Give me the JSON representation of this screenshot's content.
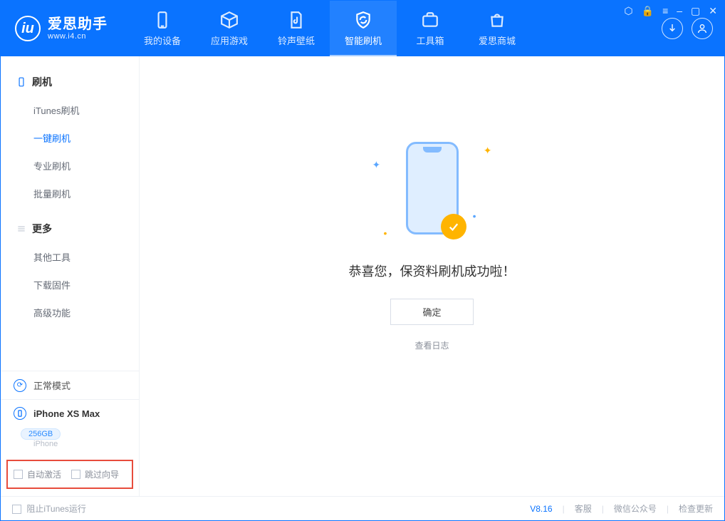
{
  "app": {
    "name": "爱思助手",
    "domain": "www.i4.cn"
  },
  "nav": {
    "items": [
      {
        "id": "device",
        "label": "我的设备"
      },
      {
        "id": "apps",
        "label": "应用游戏"
      },
      {
        "id": "ring",
        "label": "铃声壁纸"
      },
      {
        "id": "flash",
        "label": "智能刷机",
        "active": true
      },
      {
        "id": "toolbox",
        "label": "工具箱"
      },
      {
        "id": "store",
        "label": "爱思商城"
      }
    ]
  },
  "window_controls": {
    "skin": "⬡",
    "lock": "🔒",
    "menu": "≡",
    "min": "–",
    "max": "▢",
    "close": "✕"
  },
  "sidebar": {
    "flash_head": "刷机",
    "flash_items": [
      {
        "id": "itunes",
        "label": "iTunes刷机"
      },
      {
        "id": "onekey",
        "label": "一键刷机",
        "active": true
      },
      {
        "id": "pro",
        "label": "专业刷机"
      },
      {
        "id": "batch",
        "label": "批量刷机"
      }
    ],
    "more_head": "更多",
    "more_items": [
      {
        "id": "other",
        "label": "其他工具"
      },
      {
        "id": "firmware",
        "label": "下载固件"
      },
      {
        "id": "adv",
        "label": "高级功能"
      }
    ],
    "mode_label": "正常模式",
    "device": {
      "name": "iPhone XS Max",
      "capacity": "256GB",
      "type": "iPhone"
    },
    "opts": {
      "auto_activate": "自动激活",
      "skip_guide": "跳过向导"
    }
  },
  "main": {
    "message": "恭喜您，保资料刷机成功啦！",
    "ok_button": "确定",
    "view_log": "查看日志"
  },
  "statusbar": {
    "block_itunes": "阻止iTunes运行",
    "version": "V8.16",
    "support": "客服",
    "wechat": "微信公众号",
    "update": "检查更新"
  }
}
